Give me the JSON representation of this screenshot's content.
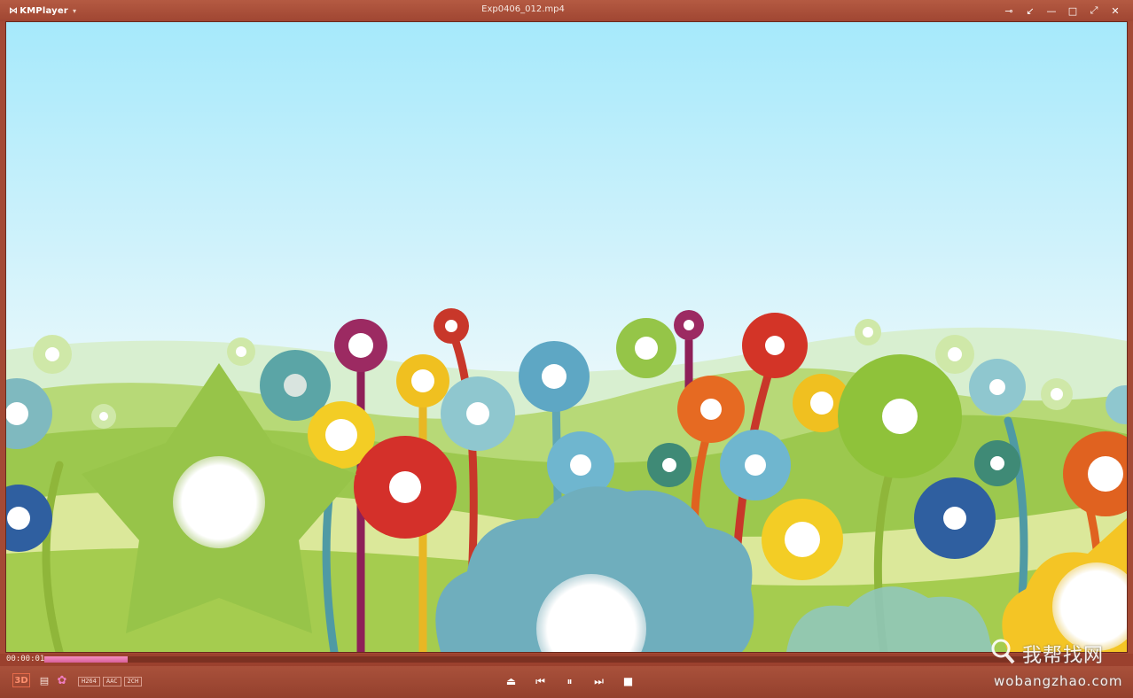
{
  "app": {
    "name": "KMPlayer",
    "window_title": "Exp0406_012.mp4"
  },
  "playback": {
    "elapsed": "00:00:01",
    "progress": 0.08
  },
  "toolbar": {
    "btn_3d": "3D",
    "codec_badges": [
      "H264",
      "AAC",
      "2CH"
    ]
  },
  "icons": {
    "logo": "kmplayer-logo-icon",
    "menu": "chevron-down-icon",
    "pin": "pin-icon",
    "minimode": "mini-mode-icon",
    "minimize": "minimize-icon",
    "maximize": "maximize-icon",
    "fullscreen": "fullscreen-icon",
    "close": "close-icon",
    "playlist": "playlist-icon",
    "settings": "gear-icon",
    "eject": "eject-icon",
    "prev": "skip-previous-icon",
    "pause": "pause-icon",
    "next": "skip-next-icon",
    "stop": "stop-icon"
  },
  "watermark": {
    "cn": "我帮找网",
    "url": "wobangzhao.com"
  },
  "colors": {
    "frame": "#a44a35",
    "seek_fill": "#e06aa4",
    "accent_3d": "#ff8f6e"
  }
}
